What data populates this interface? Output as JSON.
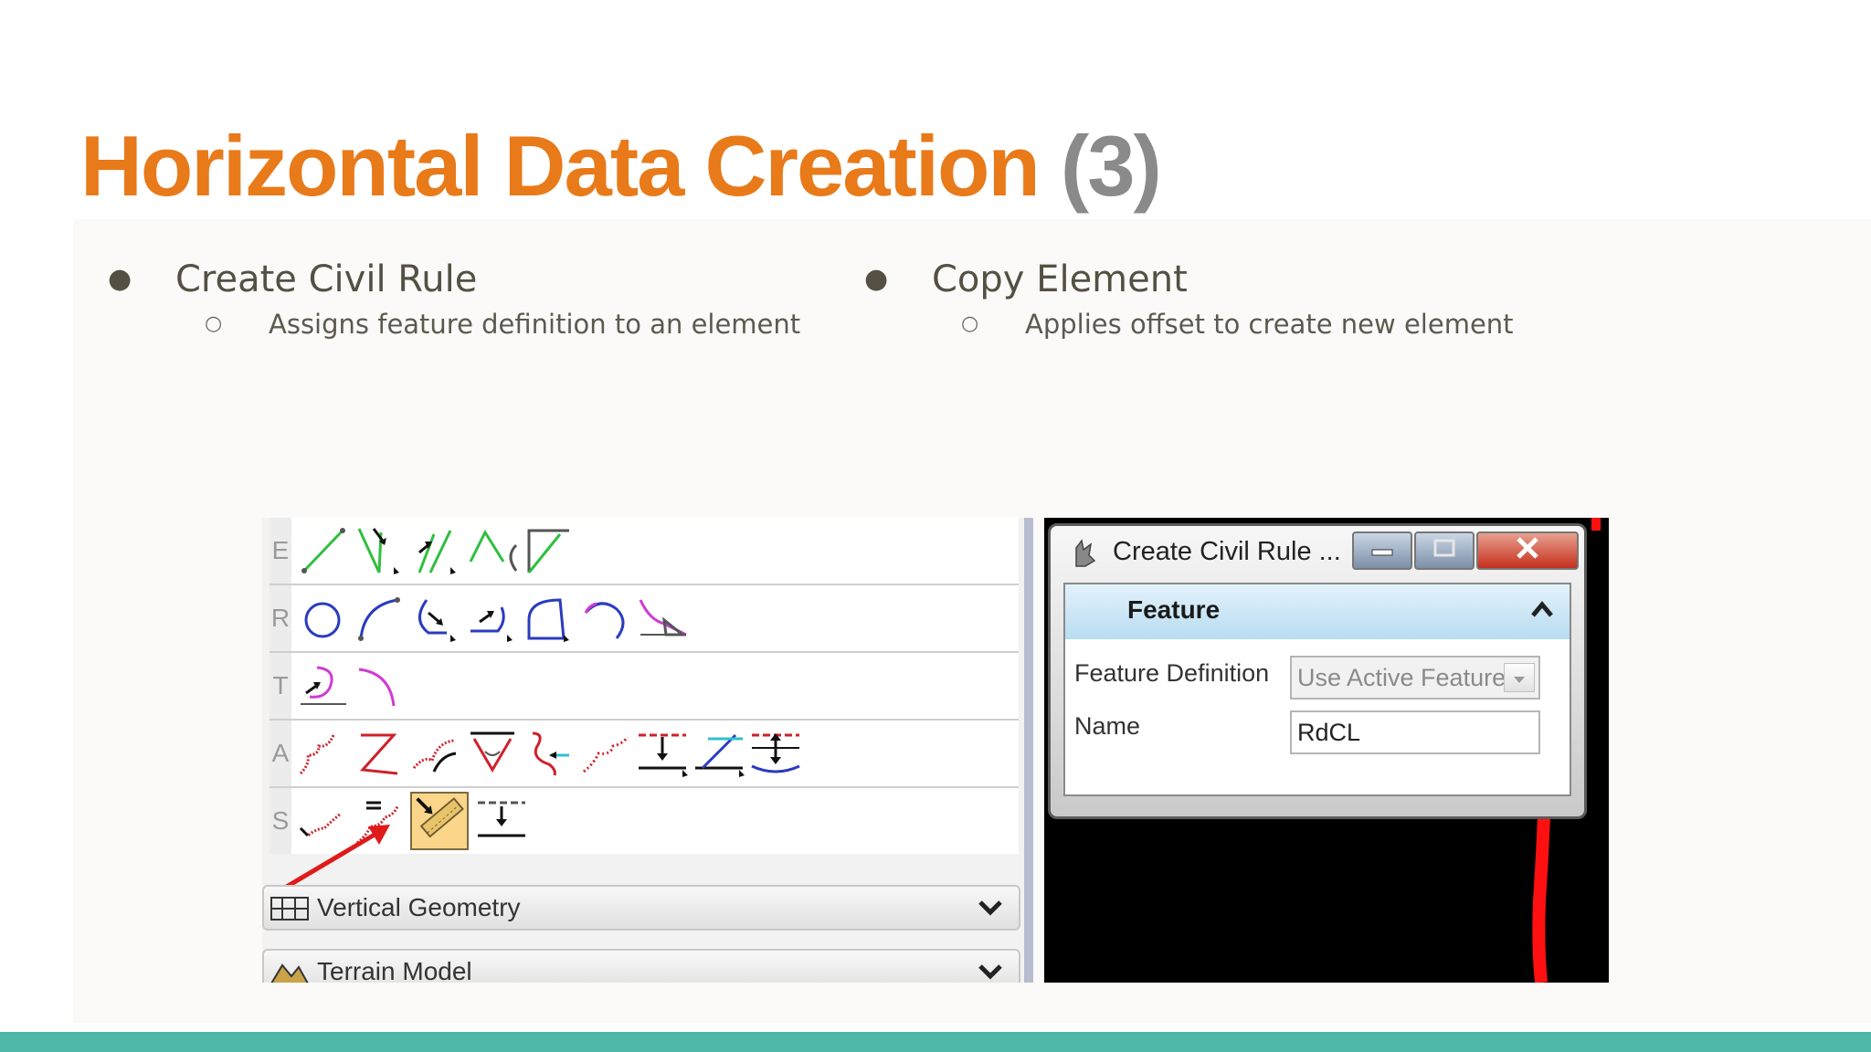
{
  "slide": {
    "title_main": "Horizontal Data Creation",
    "title_num": "(3)",
    "bullets": [
      {
        "text": "Create Civil Rule",
        "sub": "Assigns feature definition to an element"
      },
      {
        "text": "Copy Element",
        "sub": "Applies offset to create new element"
      }
    ]
  },
  "toolbox": {
    "rows": [
      "E",
      "R",
      "T",
      "A",
      "S"
    ],
    "sections": [
      {
        "label": "Vertical Geometry",
        "icon": "vertical-geometry-icon"
      },
      {
        "label": "Terrain Model",
        "icon": "terrain-model-icon"
      }
    ],
    "selected_tool_icon": "create-civil-rule-icon"
  },
  "dialog": {
    "title": "Create Civil Rule ...",
    "section": "Feature",
    "fields": [
      {
        "label": "Feature Definition",
        "value": "Use Active Feature"
      },
      {
        "label": "Name",
        "value": "RdCL"
      }
    ]
  },
  "colors": {
    "title_orange": "#e87a1a",
    "title_gray": "#8a8a8a",
    "footer_teal": "#4fb8a8",
    "cad_line_red": "#ff1010"
  }
}
